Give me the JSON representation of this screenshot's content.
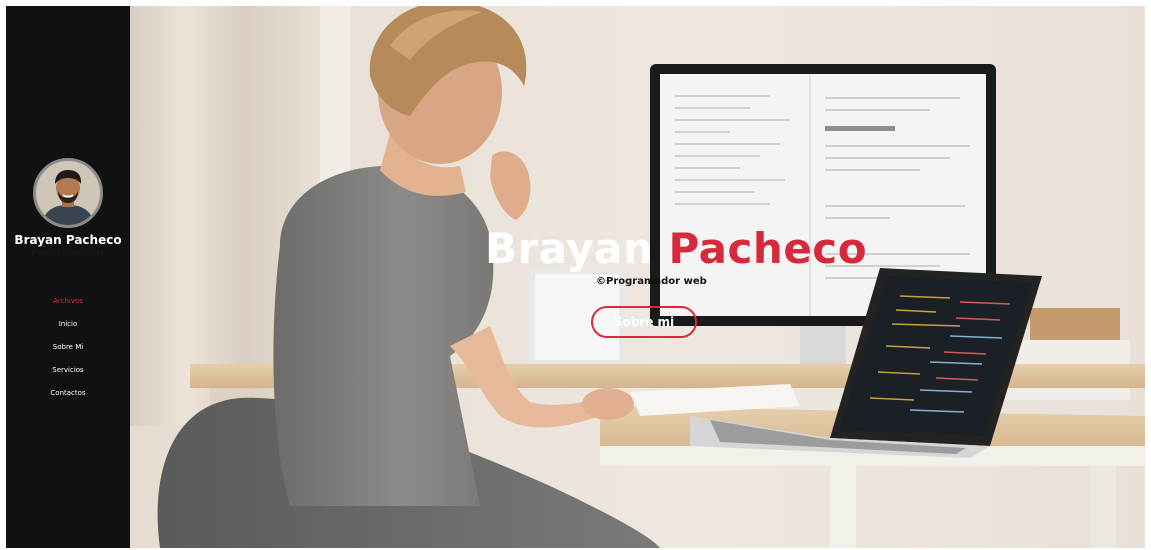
{
  "sidebar": {
    "profile": {
      "name": "Brayan Pacheco",
      "role": "Programador"
    },
    "nav": [
      {
        "label": "Archivos",
        "active": true
      },
      {
        "label": "Inicio",
        "active": false
      },
      {
        "label": "Sobre Mi",
        "active": false
      },
      {
        "label": "Servicios",
        "active": false
      },
      {
        "label": "Contactos",
        "active": false
      }
    ]
  },
  "hero": {
    "title_first": "Brayan",
    "title_last": "Pacheco",
    "subtitle": "©Programador web",
    "button_label": "Sobre mi"
  },
  "colors": {
    "accent": "#d62a3c",
    "sidebar_bg": "#111111",
    "text_light": "#ffffff"
  }
}
